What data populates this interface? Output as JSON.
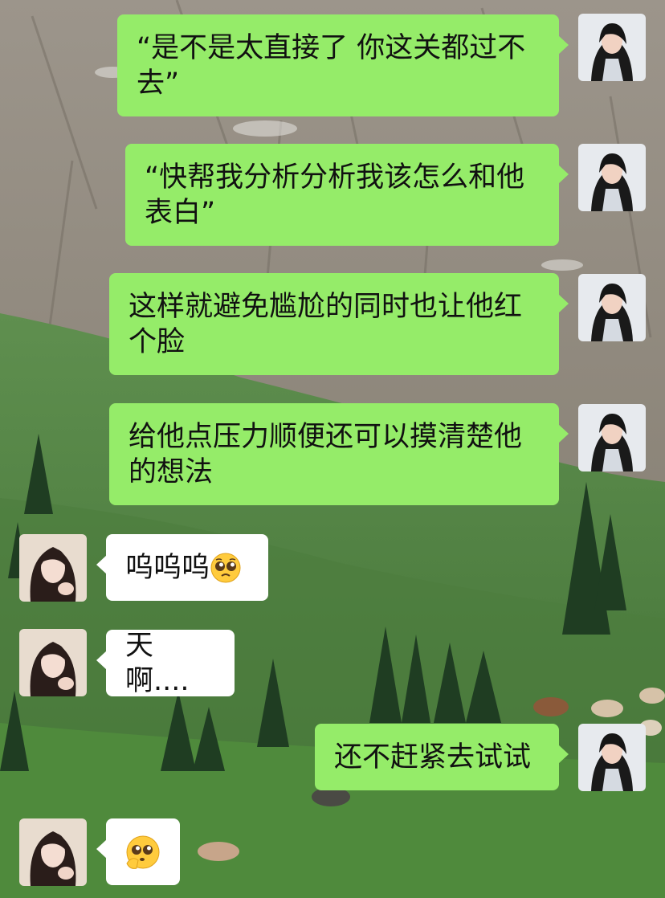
{
  "colors": {
    "self_bubble": "#95ec69",
    "other_bubble": "#ffffff",
    "text": "#111111"
  },
  "messages": [
    {
      "side": "self",
      "text": "“是不是太直接了 你这关都过不去”"
    },
    {
      "side": "self",
      "text": "“快帮我分析分析我该怎么和他表白”"
    },
    {
      "side": "self",
      "text": "这样就避免尴尬的同时也让他红个脸"
    },
    {
      "side": "self",
      "text": "给他点压力顺便还可以摸清楚他的想法"
    },
    {
      "side": "other",
      "text": "呜呜呜",
      "emoji": "pleading-face"
    },
    {
      "side": "other",
      "text": "天啊...."
    },
    {
      "side": "self",
      "text": "还不赶紧去试试"
    },
    {
      "side": "other",
      "text": "",
      "emoji": "pleading-face-saluting"
    }
  ]
}
